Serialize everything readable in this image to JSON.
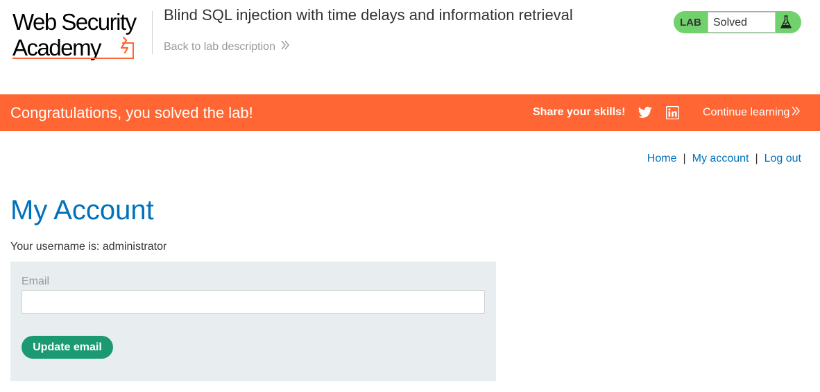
{
  "logo": {
    "line1": "Web Security",
    "line2": "Academy",
    "brand_color": "#ff6633"
  },
  "header": {
    "lab_title": "Blind SQL injection with time delays and information retrieval",
    "back_link": "Back to lab description",
    "lab_badge": "LAB",
    "status": "Solved",
    "status_color": "#70d16d",
    "status_icon": "flask-icon"
  },
  "banner": {
    "message": "Congratulations, you solved the lab!",
    "share_label": "Share your skills!",
    "share_icons": [
      "twitter-icon",
      "linkedin-icon"
    ],
    "continue_label": "Continue learning",
    "background_color": "#ff6633"
  },
  "nav": {
    "home": "Home",
    "separator": "|",
    "my_account": "My account",
    "log_out": "Log out",
    "link_color": "#0071bc"
  },
  "page": {
    "title": "My Account",
    "username_text": "Your username is: administrator"
  },
  "form": {
    "email_label": "Email",
    "email_value": "",
    "submit_label": "Update email",
    "button_color": "#1b9a72"
  }
}
